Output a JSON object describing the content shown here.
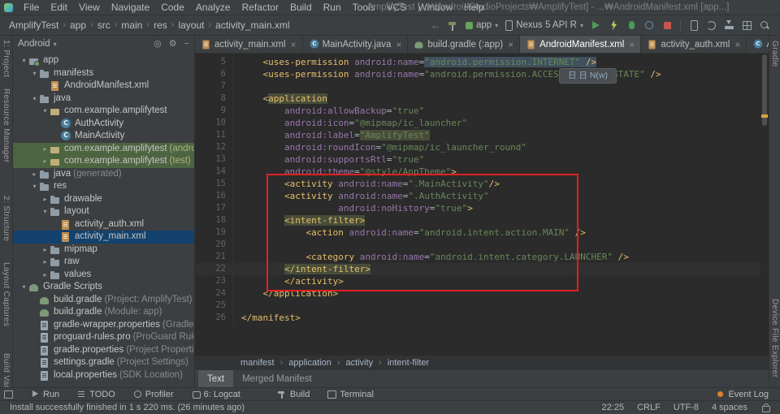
{
  "window": {
    "title": "AmplifyTest [...₩AndroidStudioProjects₩AmplifyTest] - ...₩AndroidManifest.xml [app...]"
  },
  "menubar": {
    "items": [
      "File",
      "Edit",
      "View",
      "Navigate",
      "Code",
      "Analyze",
      "Refactor",
      "Build",
      "Run",
      "Tools",
      "VCS",
      "Window",
      "Help"
    ]
  },
  "navbar": {
    "breadcrumb": [
      "AmplifyTest",
      "app",
      "src",
      "main",
      "res",
      "layout",
      "activity_main.xml"
    ],
    "run_config": {
      "module": "app",
      "device": "Nexus 5 API R"
    }
  },
  "left_stripe": {
    "items": [
      "1: Project",
      "Resource Manager",
      "2: Structure",
      "Layout Captures",
      "Build Variants"
    ]
  },
  "right_stripe": {
    "items": [
      "Gradle",
      "Device File Explorer"
    ]
  },
  "project": {
    "header": {
      "view": "Android"
    },
    "tree": [
      {
        "label": "app",
        "level": 0,
        "icon": "folder-app",
        "chev": "v"
      },
      {
        "label": "manifests",
        "level": 1,
        "icon": "folder",
        "chev": "v"
      },
      {
        "label": "AndroidManifest.xml",
        "level": 2,
        "icon": "file-manifest",
        "chev": ""
      },
      {
        "label": "java",
        "level": 1,
        "icon": "folder",
        "chev": "v"
      },
      {
        "label": "com.example.amplifytest",
        "level": 2,
        "icon": "package",
        "chev": "v"
      },
      {
        "label": "AuthActivity",
        "level": 3,
        "icon": "class",
        "chev": ""
      },
      {
        "label": "MainActivity",
        "level": 3,
        "icon": "class",
        "chev": ""
      },
      {
        "label": "com.example.amplifytest",
        "suffix": " (androidTest)",
        "level": 2,
        "icon": "package",
        "chev": ">",
        "test": true
      },
      {
        "label": "com.example.amplifytest",
        "suffix": " (test)",
        "level": 2,
        "icon": "package",
        "chev": ">",
        "test": true
      },
      {
        "label": "java",
        "suffix": " (generated)",
        "level": 1,
        "icon": "folder",
        "chev": ">"
      },
      {
        "label": "res",
        "level": 1,
        "icon": "folder-res",
        "chev": "v"
      },
      {
        "label": "drawable",
        "level": 2,
        "icon": "folder",
        "chev": ">"
      },
      {
        "label": "layout",
        "level": 2,
        "icon": "folder",
        "chev": "v"
      },
      {
        "label": "activity_auth.xml",
        "level": 3,
        "icon": "file-xml",
        "chev": ""
      },
      {
        "label": "activity_main.xml",
        "level": 3,
        "icon": "file-xml",
        "chev": "",
        "selected": true
      },
      {
        "label": "mipmap",
        "level": 2,
        "icon": "folder",
        "chev": ">"
      },
      {
        "label": "raw",
        "level": 2,
        "icon": "folder",
        "chev": ">"
      },
      {
        "label": "values",
        "level": 2,
        "icon": "folder",
        "chev": ">"
      },
      {
        "label": "Gradle Scripts",
        "level": 0,
        "icon": "gradle",
        "chev": "v"
      },
      {
        "label": "build.gradle",
        "suffix": " (Project: AmplifyTest)",
        "level": 1,
        "icon": "gradle",
        "chev": ""
      },
      {
        "label": "build.gradle",
        "suffix": " (Module: app)",
        "level": 1,
        "icon": "gradle",
        "chev": ""
      },
      {
        "label": "gradle-wrapper.properties",
        "suffix": " (Gradle Version)",
        "level": 1,
        "icon": "props",
        "chev": ""
      },
      {
        "label": "proguard-rules.pro",
        "suffix": " (ProGuard Rules for app)",
        "level": 1,
        "icon": "props",
        "chev": ""
      },
      {
        "label": "gradle.properties",
        "suffix": " (Project Properties)",
        "level": 1,
        "icon": "props",
        "chev": ""
      },
      {
        "label": "settings.gradle",
        "suffix": " (Project Settings)",
        "level": 1,
        "icon": "props",
        "chev": ""
      },
      {
        "label": "local.properties",
        "suffix": " (SDK Location)",
        "level": 1,
        "icon": "props",
        "chev": ""
      }
    ]
  },
  "editor": {
    "tabs": [
      {
        "label": "activity_main.xml",
        "icon": "file-xml",
        "active": false
      },
      {
        "label": "MainActivity.java",
        "icon": "class",
        "active": false
      },
      {
        "label": "build.gradle (:app)",
        "icon": "gradle",
        "active": false
      },
      {
        "label": "AndroidManifest.xml",
        "icon": "file-manifest",
        "active": true
      },
      {
        "label": "activity_auth.xml",
        "icon": "file-xml",
        "active": false
      },
      {
        "label": "AuthActivity.java",
        "icon": "class",
        "active": false
      }
    ],
    "lines": [
      {
        "n": 5,
        "t": [
          [
            "    ",
            "p"
          ],
          [
            "<uses-permission",
            "t"
          ],
          [
            " ",
            "p"
          ],
          [
            "android:name",
            "a"
          ],
          [
            "=",
            "p"
          ],
          [
            "\"android.permission.INTERNET\"",
            "v",
            "s"
          ],
          [
            " />",
            "t",
            "s"
          ]
        ]
      },
      {
        "n": 6,
        "t": [
          [
            "    ",
            "p"
          ],
          [
            "<uses-permission",
            "t"
          ],
          [
            " ",
            "p"
          ],
          [
            "android:name",
            "a"
          ],
          [
            "=",
            "p"
          ],
          [
            "\"android.permission.ACCESS_NETWORK_STATE\"",
            "v"
          ],
          [
            " />",
            "t"
          ]
        ]
      },
      {
        "n": 7,
        "t": []
      },
      {
        "n": 8,
        "t": [
          [
            "    ",
            "p"
          ],
          [
            "<",
            "t"
          ],
          [
            "application",
            "t",
            "i"
          ]
        ]
      },
      {
        "n": 9,
        "t": [
          [
            "        ",
            "p"
          ],
          [
            "android:allowBackup",
            "a"
          ],
          [
            "=",
            "p"
          ],
          [
            "\"true\"",
            "v"
          ]
        ]
      },
      {
        "n": 10,
        "t": [
          [
            "        ",
            "p"
          ],
          [
            "android:icon",
            "a"
          ],
          [
            "=",
            "p"
          ],
          [
            "\"@mipmap/ic_launcher\"",
            "v"
          ]
        ]
      },
      {
        "n": 11,
        "t": [
          [
            "        ",
            "p"
          ],
          [
            "android:label",
            "a"
          ],
          [
            "=",
            "p"
          ],
          [
            "\"AmplifyTest\"",
            "v",
            "i"
          ]
        ]
      },
      {
        "n": 12,
        "t": [
          [
            "        ",
            "p"
          ],
          [
            "android:roundIcon",
            "a"
          ],
          [
            "=",
            "p"
          ],
          [
            "\"@mipmap/ic_launcher_round\"",
            "v"
          ]
        ]
      },
      {
        "n": 13,
        "t": [
          [
            "        ",
            "p"
          ],
          [
            "android:supportsRtl",
            "a"
          ],
          [
            "=",
            "p"
          ],
          [
            "\"true\"",
            "v"
          ]
        ]
      },
      {
        "n": 14,
        "t": [
          [
            "        ",
            "p"
          ],
          [
            "android:theme",
            "a"
          ],
          [
            "=",
            "p"
          ],
          [
            "\"@style/AppTheme\"",
            "v"
          ],
          [
            ">",
            "t"
          ]
        ]
      },
      {
        "n": 15,
        "t": [
          [
            "        ",
            "p"
          ],
          [
            "<activity",
            "t"
          ],
          [
            " ",
            "p"
          ],
          [
            "android:name",
            "a"
          ],
          [
            "=",
            "p"
          ],
          [
            "\".MainActivity\"",
            "v"
          ],
          [
            "/>",
            "t"
          ]
        ]
      },
      {
        "n": 16,
        "t": [
          [
            "        ",
            "p"
          ],
          [
            "<activity",
            "t"
          ],
          [
            " ",
            "p"
          ],
          [
            "android:name",
            "a"
          ],
          [
            "=",
            "p"
          ],
          [
            "\".AuthActivity\"",
            "v"
          ]
        ]
      },
      {
        "n": 17,
        "t": [
          [
            "                  ",
            "p"
          ],
          [
            "android:noHistory",
            "a"
          ],
          [
            "=",
            "p"
          ],
          [
            "\"true\"",
            "v"
          ],
          [
            ">",
            "t"
          ]
        ]
      },
      {
        "n": 18,
        "t": [
          [
            "        ",
            "p"
          ],
          [
            "<intent-filter>",
            "t",
            "i"
          ]
        ]
      },
      {
        "n": 19,
        "t": [
          [
            "            ",
            "p"
          ],
          [
            "<action",
            "t"
          ],
          [
            " ",
            "p"
          ],
          [
            "android:name",
            "a"
          ],
          [
            "=",
            "p"
          ],
          [
            "\"android.intent.action.MAIN\"",
            "v"
          ],
          [
            " />",
            "t"
          ]
        ]
      },
      {
        "n": 20,
        "t": []
      },
      {
        "n": 21,
        "t": [
          [
            "            ",
            "p"
          ],
          [
            "<category",
            "t"
          ],
          [
            " ",
            "p"
          ],
          [
            "android:name",
            "a"
          ],
          [
            "=",
            "p"
          ],
          [
            "\"android.intent.category.LAUNCHER\"",
            "v"
          ],
          [
            " />",
            "t"
          ]
        ]
      },
      {
        "n": 22,
        "t": [
          [
            "        ",
            "p"
          ],
          [
            "</intent-filter>",
            "t",
            "i"
          ]
        ],
        "cur": true
      },
      {
        "n": 23,
        "t": [
          [
            "        ",
            "p"
          ],
          [
            "</activity>",
            "t"
          ]
        ]
      },
      {
        "n": 24,
        "t": [
          [
            "    ",
            "p"
          ],
          [
            "</application>",
            "t"
          ]
        ]
      },
      {
        "n": 25,
        "t": []
      },
      {
        "n": 26,
        "t": [
          [
            "</manifest>",
            "t"
          ]
        ]
      }
    ],
    "breadcrumb": [
      "manifest",
      "application",
      "activity",
      "intent-filter"
    ],
    "bottom_tabs": [
      {
        "label": "Text",
        "active": true
      },
      {
        "label": "Merged Manifest",
        "active": false
      }
    ],
    "tooltip": "日 日 N(w)"
  },
  "bottom_bar": {
    "items": [
      {
        "label": "Run",
        "icon": "run"
      },
      {
        "label": "TODO",
        "icon": "todo"
      },
      {
        "label": "Profiler",
        "icon": "profiler"
      },
      {
        "label": "6: Logcat",
        "icon": "logcat"
      },
      {
        "label": "Build",
        "icon": "build",
        "gap": true
      },
      {
        "label": "Terminal",
        "icon": "terminal"
      }
    ],
    "right": [
      {
        "label": "Event Log",
        "icon": "eventlog"
      }
    ]
  },
  "status_bar": {
    "message": "Install successfully finished in 1 s 220 ms. (26 minutes ago)",
    "items": [
      "22:25",
      "CRLF",
      "UTF-8",
      "4 spaces"
    ]
  },
  "colors": {
    "annotation_red": "#e02020",
    "selection_blue": "#12426d",
    "test_green": "#4d6440",
    "tag": "#e8bf6a",
    "attribute": "#9876aa",
    "string": "#6a8759",
    "editor_bg": "#2b2b2b",
    "panel_bg": "#3c3f41"
  }
}
